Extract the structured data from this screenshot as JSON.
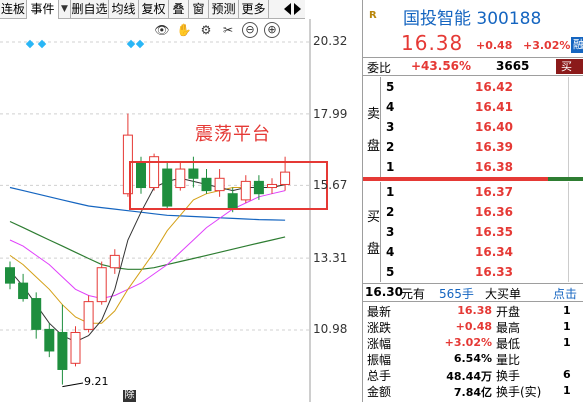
{
  "tabs": [
    {
      "label": "连板",
      "active": false
    },
    {
      "label": "事件",
      "active": true
    },
    {
      "label": "▼",
      "active": false
    },
    {
      "label": "删自选",
      "active": false
    },
    {
      "label": "均线",
      "active": false
    },
    {
      "label": "复权",
      "active": false
    },
    {
      "label": "叠",
      "active": false
    },
    {
      "label": "窗",
      "active": false
    },
    {
      "label": "预测",
      "active": false
    },
    {
      "label": "更多",
      "active": false
    }
  ],
  "toolbar": [
    "👁",
    "✋",
    "⚙",
    "✂",
    "⊖",
    "⊕"
  ],
  "y_axis": [
    "20.32",
    "17.99",
    "15.67",
    "13.31",
    "10.98"
  ],
  "annotation": "震荡平台",
  "low_label": "9.21",
  "bottom_badge": "除",
  "colors": {
    "up": "#e53935",
    "down": "#1e8e3e",
    "ma5": "#333333",
    "ma10": "#d4a017",
    "ma20": "#e040fb",
    "ma60": "#2e7d32",
    "ma_long": "#1565c0",
    "box": "#e53935"
  },
  "chart_data": {
    "type": "candlestick",
    "y_ticks": [
      20.32,
      17.99,
      15.67,
      13.31,
      10.98
    ],
    "low_marker": 9.21,
    "candles": [
      {
        "o": 13.0,
        "h": 13.2,
        "l": 12.3,
        "c": 12.5
      },
      {
        "o": 12.5,
        "h": 12.8,
        "l": 11.9,
        "c": 12.0
      },
      {
        "o": 12.0,
        "h": 12.2,
        "l": 10.7,
        "c": 11.0
      },
      {
        "o": 11.0,
        "h": 11.2,
        "l": 10.1,
        "c": 10.3
      },
      {
        "o": 10.9,
        "h": 11.8,
        "l": 9.21,
        "c": 9.7
      },
      {
        "o": 9.9,
        "h": 11.1,
        "l": 9.8,
        "c": 10.9
      },
      {
        "o": 11.0,
        "h": 12.1,
        "l": 10.9,
        "c": 11.9
      },
      {
        "o": 11.9,
        "h": 13.2,
        "l": 11.8,
        "c": 13.0
      },
      {
        "o": 13.0,
        "h": 13.6,
        "l": 12.8,
        "c": 13.4
      },
      {
        "o": 15.4,
        "h": 18.0,
        "l": 15.3,
        "c": 17.3
      },
      {
        "o": 16.4,
        "h": 16.6,
        "l": 15.4,
        "c": 15.6
      },
      {
        "o": 15.6,
        "h": 16.7,
        "l": 15.5,
        "c": 16.6
      },
      {
        "o": 16.2,
        "h": 16.4,
        "l": 14.9,
        "c": 15.0
      },
      {
        "o": 15.6,
        "h": 16.4,
        "l": 15.5,
        "c": 16.2
      },
      {
        "o": 16.2,
        "h": 16.6,
        "l": 15.6,
        "c": 15.9
      },
      {
        "o": 15.9,
        "h": 16.2,
        "l": 15.4,
        "c": 15.5
      },
      {
        "o": 15.5,
        "h": 16.2,
        "l": 15.3,
        "c": 15.9
      },
      {
        "o": 15.4,
        "h": 15.6,
        "l": 14.8,
        "c": 14.9
      },
      {
        "o": 15.2,
        "h": 16.0,
        "l": 15.1,
        "c": 15.8
      },
      {
        "o": 15.8,
        "h": 16.0,
        "l": 15.2,
        "c": 15.4
      },
      {
        "o": 15.6,
        "h": 15.9,
        "l": 15.4,
        "c": 15.7
      },
      {
        "o": 15.7,
        "h": 16.6,
        "l": 15.5,
        "c": 16.1
      }
    ],
    "ma5": [
      12.9,
      12.4,
      11.8,
      11.2,
      10.8,
      10.6,
      10.8,
      11.3,
      12.3,
      13.9,
      14.8,
      15.6,
      15.8,
      15.9,
      15.8,
      15.7,
      15.6,
      15.5,
      15.6,
      15.6,
      15.6,
      15.7
    ],
    "ma10": [
      13.4,
      13.1,
      12.7,
      12.3,
      11.8,
      11.4,
      11.2,
      11.2,
      11.6,
      12.3,
      12.9,
      13.5,
      14.2,
      14.7,
      15.2,
      15.4,
      15.5,
      15.6,
      15.6,
      15.6,
      15.6,
      15.7
    ],
    "ma20": [
      13.9,
      13.7,
      13.4,
      13.1,
      12.7,
      12.3,
      12.1,
      12.0,
      12.1,
      12.3,
      12.5,
      12.8,
      13.1,
      13.5,
      13.9,
      14.3,
      14.6,
      14.9,
      15.1,
      15.3,
      15.4,
      15.5
    ],
    "ma60": [
      14.5,
      14.3,
      14.1,
      13.9,
      13.7,
      13.5,
      13.3,
      13.1,
      13.0,
      12.95,
      12.95,
      13.0,
      13.1,
      13.2,
      13.3,
      13.4,
      13.5,
      13.6,
      13.7,
      13.8,
      13.9,
      14.0
    ],
    "ma_long": [
      15.6,
      15.5,
      15.4,
      15.3,
      15.2,
      15.1,
      15.0,
      14.95,
      14.9,
      14.85,
      14.8,
      14.75,
      14.7,
      14.68,
      14.66,
      14.64,
      14.62,
      14.6,
      14.58,
      14.56,
      14.55,
      14.54
    ]
  },
  "quote": {
    "r_mark": "R",
    "title": "国投智能 300188",
    "price": "16.38",
    "change": "+0.48",
    "change_pct": "+3.02%",
    "margin_badge": "融",
    "weibi_label": "委比",
    "weibi_pct": "+43.56%",
    "weibi_val": "3665",
    "weibi_btn": "买",
    "sell_side": [
      "卖",
      "盘"
    ],
    "buy_side": [
      "买",
      "盘"
    ],
    "sell": [
      {
        "i": "5",
        "p": "16.42"
      },
      {
        "i": "4",
        "p": "16.41"
      },
      {
        "i": "3",
        "p": "16.40"
      },
      {
        "i": "2",
        "p": "16.39"
      },
      {
        "i": "1",
        "p": "16.38"
      }
    ],
    "buy": [
      {
        "i": "1",
        "p": "16.37"
      },
      {
        "i": "2",
        "p": "16.36"
      },
      {
        "i": "3",
        "p": "16.35"
      },
      {
        "i": "4",
        "p": "16.34"
      },
      {
        "i": "5",
        "p": "16.33"
      }
    ],
    "trade": {
      "price": "16.30",
      "unit": "元有",
      "vol": "565手",
      "type": "大买单",
      "click": "点击"
    },
    "stats": [
      {
        "l": "最新",
        "v": "16.38",
        "vc": "red",
        "l2": "开盘",
        "v2": "1"
      },
      {
        "l": "涨跌",
        "v": "+0.48",
        "vc": "red",
        "l2": "最高",
        "v2": "1"
      },
      {
        "l": "涨幅",
        "v": "+3.02%",
        "vc": "red",
        "l2": "最低",
        "v2": "1"
      },
      {
        "l": "振幅",
        "v": "6.54%",
        "vc": "",
        "l2": "量比",
        "v2": ""
      },
      {
        "l": "总手",
        "v": "48.44万",
        "vc": "",
        "l2": "换手",
        "v2": "6"
      },
      {
        "l": "金额",
        "v": "7.84亿",
        "vc": "",
        "l2": "换手(实)",
        "v2": "1"
      }
    ]
  }
}
